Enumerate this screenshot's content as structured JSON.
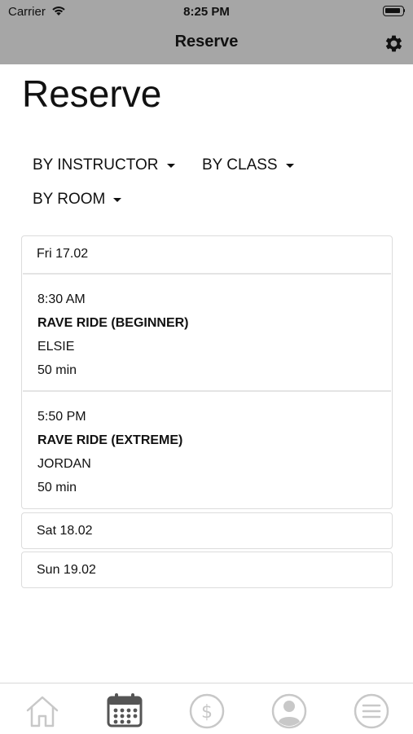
{
  "status_bar": {
    "carrier": "Carrier",
    "time": "8:25 PM"
  },
  "nav": {
    "title": "Reserve",
    "settings_icon": "gear-icon"
  },
  "page": {
    "title": "Reserve"
  },
  "filters": [
    {
      "label": "BY INSTRUCTOR"
    },
    {
      "label": "BY CLASS"
    },
    {
      "label": "BY ROOM"
    }
  ],
  "schedule": [
    {
      "day": "Fri 17.02",
      "sessions": [
        {
          "time": "8:30 AM",
          "name": "RAVE RIDE (BEGINNER)",
          "instructor": "ELSIE",
          "duration": "50 min"
        },
        {
          "time": "5:50 PM",
          "name": "RAVE RIDE (EXTREME)",
          "instructor": "JORDAN",
          "duration": "50 min"
        }
      ]
    },
    {
      "day": "Sat 18.02",
      "sessions": []
    },
    {
      "day": "Sun 19.02",
      "sessions": []
    }
  ],
  "tab_bar": {
    "tabs": [
      {
        "icon": "home-icon",
        "active": false
      },
      {
        "icon": "calendar-icon",
        "active": true
      },
      {
        "icon": "dollar-icon",
        "active": false
      },
      {
        "icon": "profile-icon",
        "active": false
      },
      {
        "icon": "menu-icon",
        "active": false
      }
    ],
    "colors": {
      "active": "#555555",
      "inactive": "#c8c8c8"
    }
  },
  "colors": {
    "nav_background": "#a6a6a6",
    "card_border": "#dcdcdc"
  }
}
